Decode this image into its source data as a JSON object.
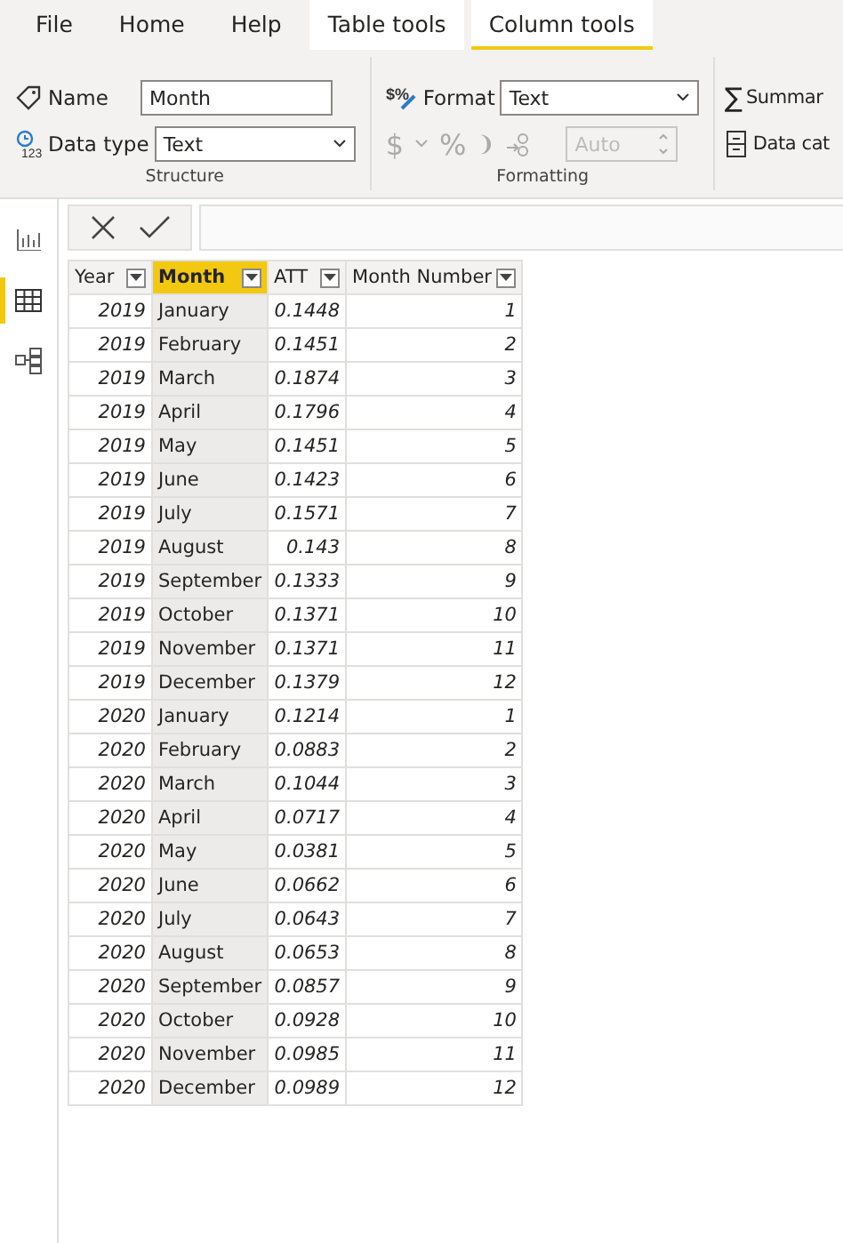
{
  "menu_tabs": [
    {
      "label": "File",
      "contextual": false,
      "selected": false
    },
    {
      "label": "Home",
      "contextual": false,
      "selected": false
    },
    {
      "label": "Help",
      "contextual": false,
      "selected": false
    },
    {
      "label": "Table tools",
      "contextual": true,
      "selected": false
    },
    {
      "label": "Column tools",
      "contextual": true,
      "selected": true
    }
  ],
  "ribbon": {
    "structure": {
      "name_label": "Name",
      "name_value": "Month",
      "data_type_label": "Data type",
      "data_type_icon_text": "123",
      "data_type_value": "Text",
      "group_label": "Structure"
    },
    "formatting": {
      "format_icon_text": "$%",
      "format_label": "Format",
      "format_value": "Text",
      "currency_symbol": "$",
      "percent_symbol": "%",
      "comma_symbol": "❩",
      "decimals_value": "Auto",
      "group_label": "Formatting"
    },
    "properties": {
      "summarization_icon": "∑",
      "summarization_label": "Summar",
      "data_category_label": "Data cat"
    }
  },
  "sidebar": {
    "items": [
      {
        "kind": "report",
        "selected": false
      },
      {
        "kind": "data",
        "selected": true
      },
      {
        "kind": "model",
        "selected": false
      }
    ]
  },
  "table": {
    "columns": [
      {
        "label": "Year",
        "selected": false
      },
      {
        "label": "Month",
        "selected": true
      },
      {
        "label": "ATT",
        "selected": false
      },
      {
        "label": "Month Number",
        "selected": false
      }
    ],
    "rows": [
      [
        "2019",
        "January",
        "0.1448",
        "1"
      ],
      [
        "2019",
        "February",
        "0.1451",
        "2"
      ],
      [
        "2019",
        "March",
        "0.1874",
        "3"
      ],
      [
        "2019",
        "April",
        "0.1796",
        "4"
      ],
      [
        "2019",
        "May",
        "0.1451",
        "5"
      ],
      [
        "2019",
        "June",
        "0.1423",
        "6"
      ],
      [
        "2019",
        "July",
        "0.1571",
        "7"
      ],
      [
        "2019",
        "August",
        "0.143",
        "8"
      ],
      [
        "2019",
        "September",
        "0.1333",
        "9"
      ],
      [
        "2019",
        "October",
        "0.1371",
        "10"
      ],
      [
        "2019",
        "November",
        "0.1371",
        "11"
      ],
      [
        "2019",
        "December",
        "0.1379",
        "12"
      ],
      [
        "2020",
        "January",
        "0.1214",
        "1"
      ],
      [
        "2020",
        "February",
        "0.0883",
        "2"
      ],
      [
        "2020",
        "March",
        "0.1044",
        "3"
      ],
      [
        "2020",
        "April",
        "0.0717",
        "4"
      ],
      [
        "2020",
        "May",
        "0.0381",
        "5"
      ],
      [
        "2020",
        "June",
        "0.0662",
        "6"
      ],
      [
        "2020",
        "July",
        "0.0643",
        "7"
      ],
      [
        "2020",
        "August",
        "0.0653",
        "8"
      ],
      [
        "2020",
        "September",
        "0.0857",
        "9"
      ],
      [
        "2020",
        "October",
        "0.0928",
        "10"
      ],
      [
        "2020",
        "November",
        "0.0985",
        "11"
      ],
      [
        "2020",
        "December",
        "0.0989",
        "12"
      ]
    ]
  }
}
